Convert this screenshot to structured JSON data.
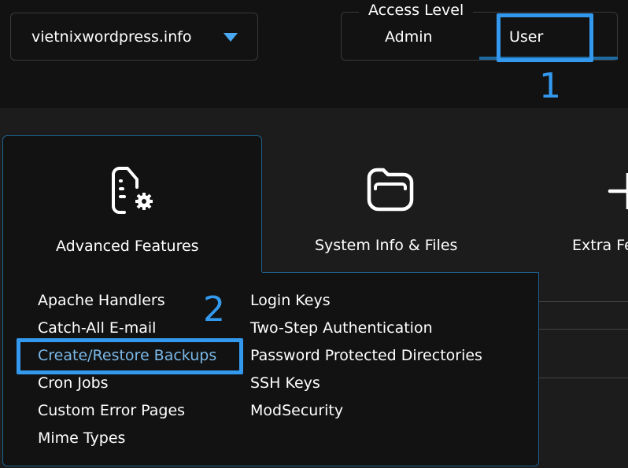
{
  "domain_selector": {
    "value": "vietnixwordpress.info",
    "icon": "caret-down-icon"
  },
  "access_level": {
    "legend": "Access Level",
    "options": [
      "Admin",
      "User"
    ],
    "selected": "User"
  },
  "annotations": [
    "1",
    "2"
  ],
  "tiles": [
    {
      "label": "Advanced Features",
      "icon": "document-gear-icon"
    },
    {
      "label": "System Info & Files",
      "icon": "folder-icon"
    },
    {
      "label": "Extra Fe",
      "icon": "plus-icon"
    }
  ],
  "menu": {
    "left": [
      "Apache Handlers",
      "Catch-All E-mail",
      "Create/Restore Backups",
      "Cron Jobs",
      "Custom Error Pages",
      "Mime Types"
    ],
    "right": [
      "Login Keys",
      "Two-Step Authentication",
      "Password Protected Directories",
      "SSH Keys",
      "ModSecurity"
    ],
    "active": "Create/Restore Backups"
  },
  "colors": {
    "accent": "#3399ee",
    "active_link": "#7ab8e8",
    "border": "#1f5f8b"
  }
}
